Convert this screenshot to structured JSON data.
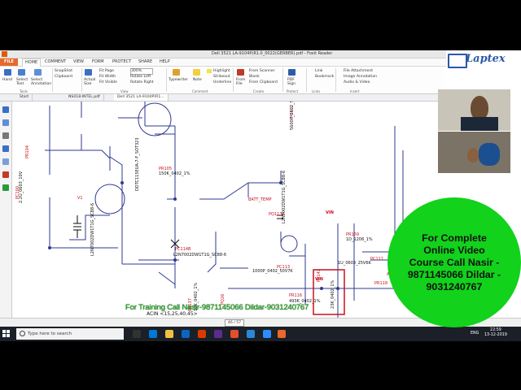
{
  "window": {
    "title": "Dell 3521 LA-9104P(R1.0_0022(GERBER).pdf - Foxit Reader"
  },
  "menu": {
    "file": "FILE",
    "tabs": [
      "HOME",
      "COMMENT",
      "VIEW",
      "FORM",
      "PROTECT",
      "SHARE",
      "HELP"
    ]
  },
  "ribbon": {
    "tools": {
      "hand": "Hand",
      "select_text": "Select Text",
      "select_annotation": "Select Annotation",
      "label": "Tools"
    },
    "clipboard": {
      "snapshot": "SnapShot",
      "clipboard": "Clipboard"
    },
    "view": {
      "actual_size": "Actual Size",
      "zoom": "300%",
      "fit_page": "Fit Page",
      "fit_width": "Fit Width",
      "fit_visible": "Fit Visible",
      "rotate_left": "Rotate Left",
      "rotate_right": "Rotate Right",
      "label": "View"
    },
    "comment": {
      "typewriter": "Typewriter",
      "note": "Note",
      "highlight": "Highlight",
      "strikeout": "Strikeout",
      "underline": "Underline",
      "label": "Comment"
    },
    "create": {
      "from_file": "From File",
      "from_scanner": "From Scanner",
      "blank": "Blank",
      "from_clipboard": "From Clipboard",
      "label": "Create"
    },
    "protect": {
      "pdf_sign": "PDF Sign",
      "label": "Protect"
    },
    "links": {
      "link": "Link",
      "bookmark": "Bookmark",
      "label": "Links"
    },
    "insert": {
      "file_attachment": "File Attachment",
      "image_annotation": "Image Annotation",
      "audio_video": "Audio & Video",
      "label": "Insert"
    }
  },
  "brand": {
    "name": "Laptex"
  },
  "doc_tabs": [
    "Start",
    "NS018-INTEL.pdf",
    "Dell 3521 LA-9104P(R1..."
  ],
  "schematic": {
    "labels": [
      "PR104",
      "PC100",
      "2.2U_0603_10V",
      "V1",
      "PR105",
      "150K_0402_1%",
      "DDTC115EUA-7-F_SOT323",
      "PC102",
      "5600P_0402_50V7K",
      "BATT_TEMP",
      "PQ113A",
      "L2N7002DW1T1G_SC88-6",
      "PC114B",
      "L2N7002DW1T1G_SC88-6",
      "VIN",
      "PR169",
      "1D_1206_1%",
      "PC111",
      "1U_0603_25V6K",
      "PC113",
      "1000P_0402_50V7K",
      "PR116",
      "493K_0402_1%",
      "VIN",
      "PR142",
      "23K_0402_1%",
      "ACIN",
      "<15,25,40,45>",
      "PR139",
      "200K_0402_1%",
      "ACIN",
      "+5VALW",
      "EC_SMB_CK1",
      "PR137",
      "10K_0402_1%",
      "L2N7002DW1T1G_SC88-6",
      "0_0402_5%",
      "ACS",
      "PR118",
      "PQ26"
    ]
  },
  "status": {
    "page": "46 / 57"
  },
  "ticker": {
    "text": "For Training Call Nasir-9871145066 Dildar-9031240767"
  },
  "promo": {
    "text": "For Complete Online Video Course Call Nasir - 9871145066 Dildar - 9031240767"
  },
  "taskbar": {
    "search_placeholder": "Type here to search",
    "time": "22:59",
    "date": "13-12-2019",
    "lang": "ENG"
  },
  "colors": {
    "wire": "#2f3a8f",
    "ref": "#c8101f",
    "promo": "#12d21b",
    "ticker": "#1db51d",
    "ribbon_file": "#e8692b"
  }
}
